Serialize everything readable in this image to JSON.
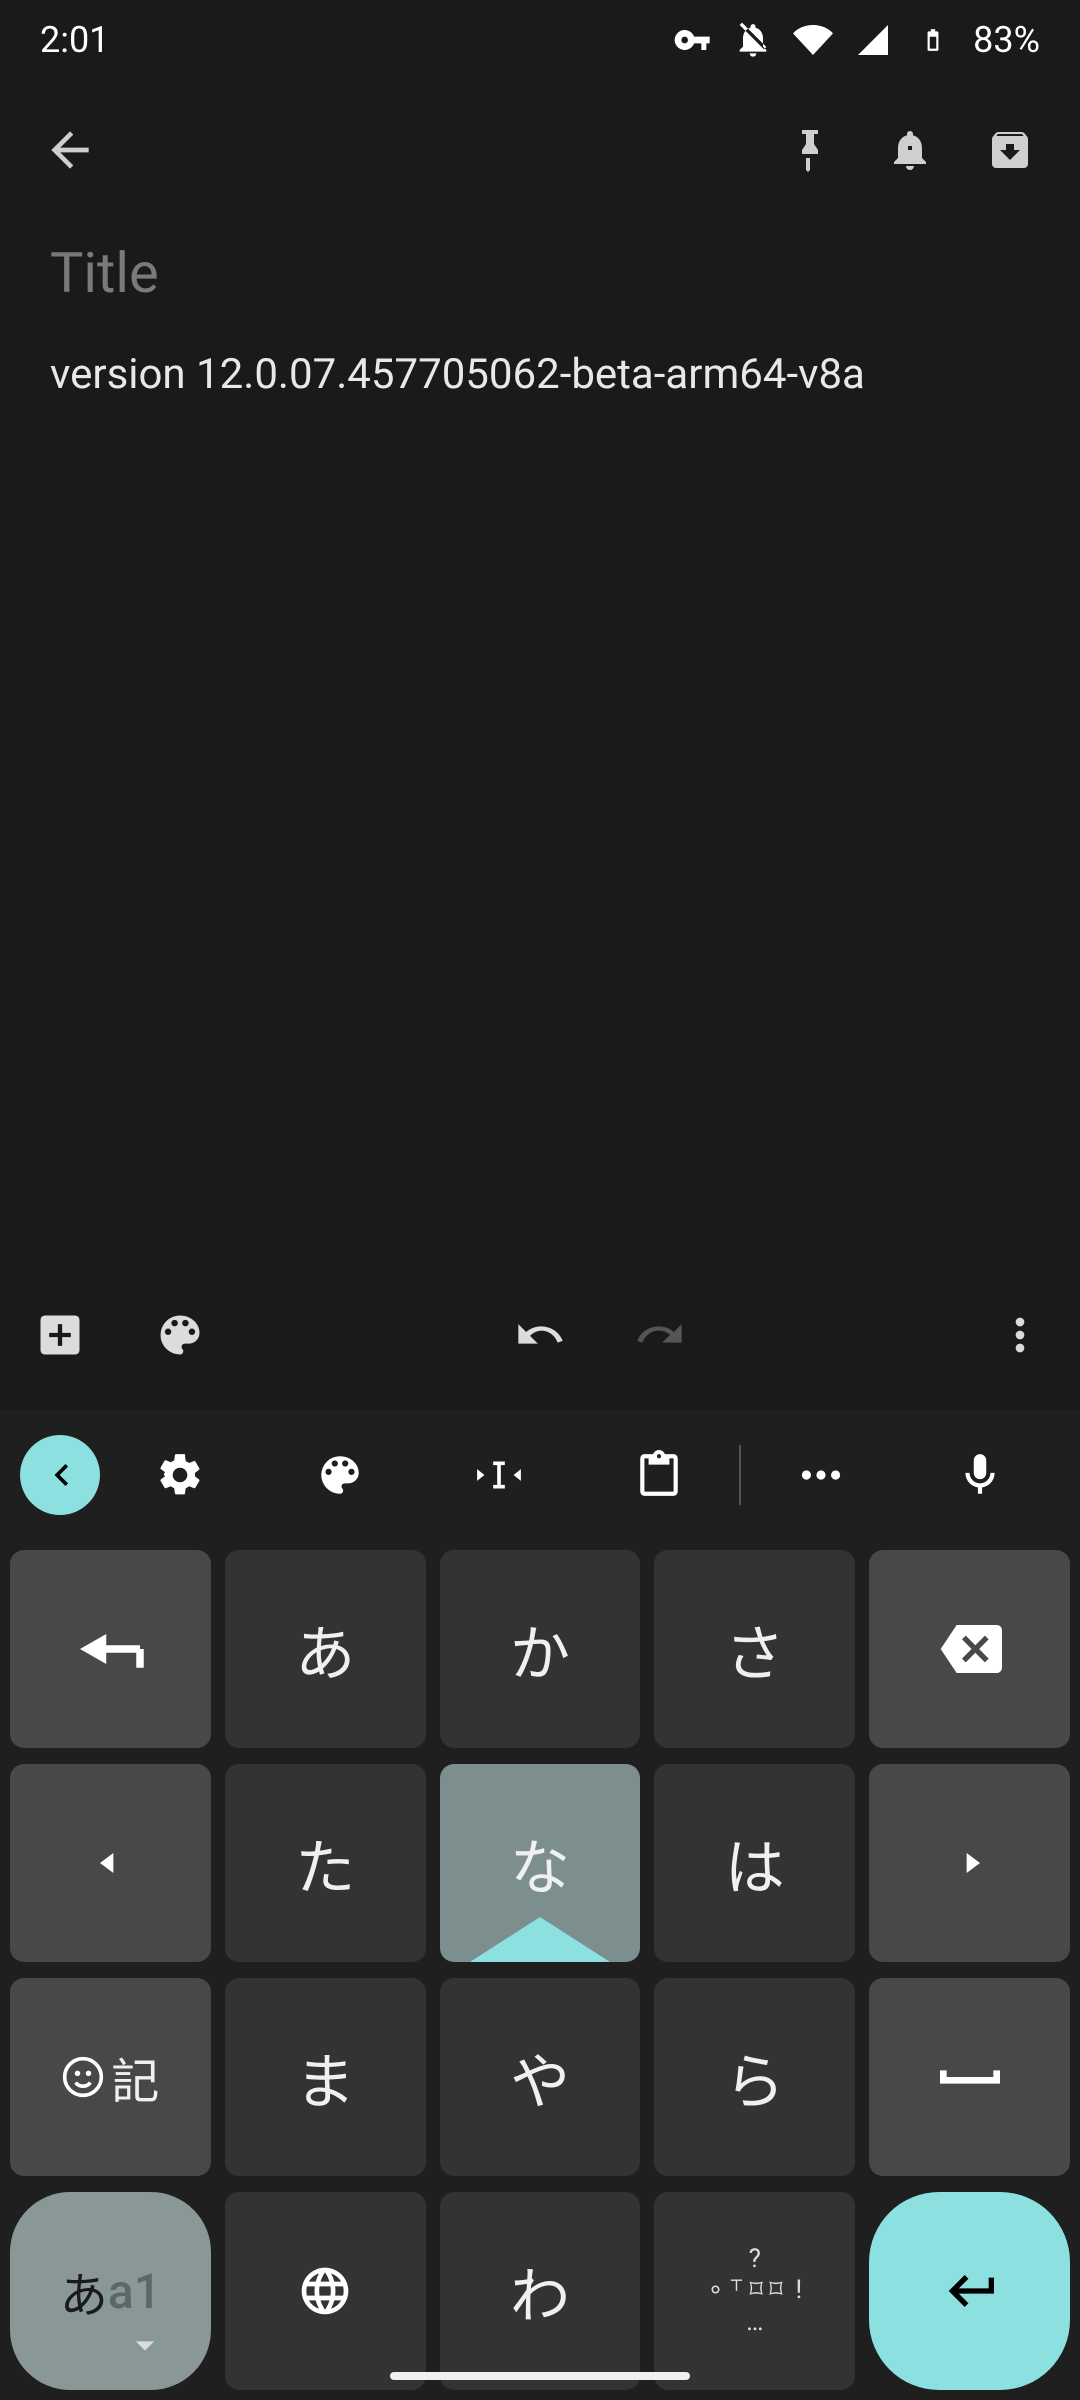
{
  "status": {
    "time": "2:01",
    "battery": "83%"
  },
  "note": {
    "title_placeholder": "Title",
    "body": "version 12.0.07.457705062-beta-arm64-v8a"
  },
  "keyboard": {
    "rows": [
      {
        "k1": "あ",
        "k2": "か",
        "k3": "さ"
      },
      {
        "k1": "た",
        "k2": "な",
        "k3": "は"
      },
      {
        "k1": "ま",
        "k2": "や",
        "k3": "ら"
      },
      {
        "k1": "わ"
      }
    ],
    "emoji_label": "記",
    "mode_a": "あ",
    "mode_b": "a1",
    "punct_q": "?",
    "punct_bang": "!",
    "punct_dots": "…"
  }
}
